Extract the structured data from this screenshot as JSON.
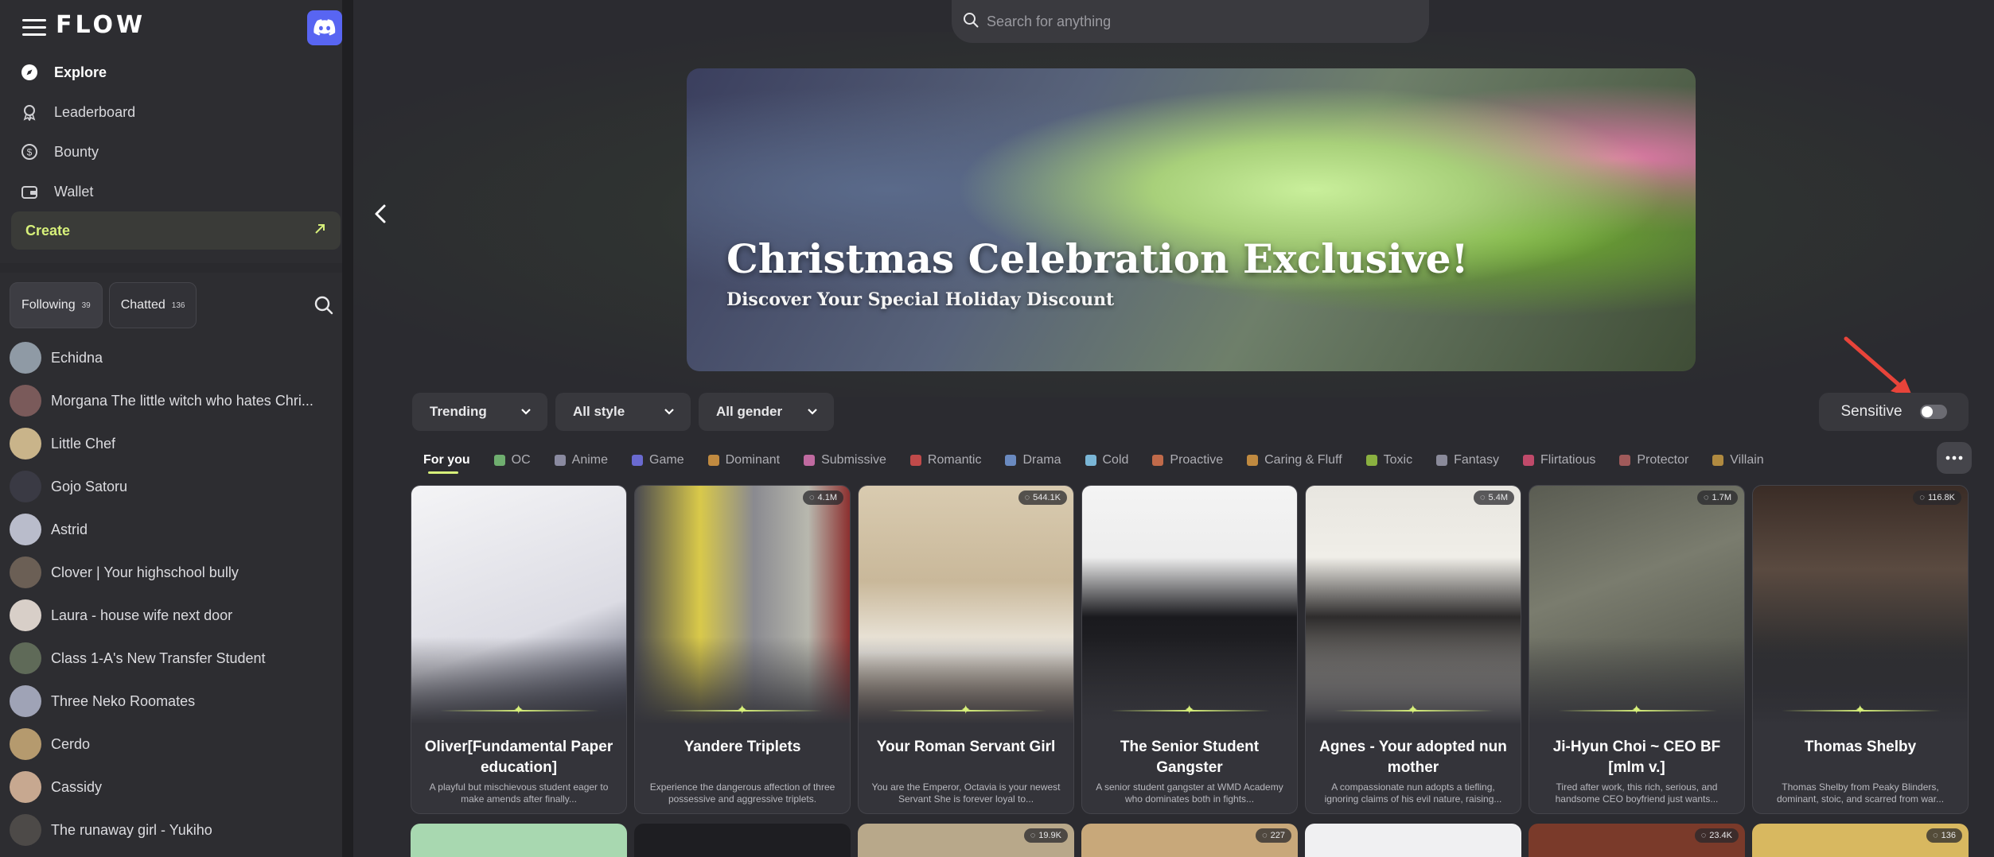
{
  "app": {
    "logo": "FLOW",
    "discord_icon": "discord-icon"
  },
  "nav": {
    "items": [
      {
        "label": "Explore",
        "icon": "compass-icon",
        "active": true
      },
      {
        "label": "Leaderboard",
        "icon": "medal-icon",
        "active": false
      },
      {
        "label": "Bounty",
        "icon": "dollar-icon",
        "active": false
      },
      {
        "label": "Wallet",
        "icon": "wallet-icon",
        "active": false
      }
    ],
    "create_label": "Create"
  },
  "sidebar": {
    "tabs": [
      {
        "label": "Following",
        "count": "39",
        "active": true
      },
      {
        "label": "Chatted",
        "count": "136",
        "active": false
      }
    ],
    "chats": [
      {
        "name": "Echidna",
        "color": "#8f9aa5"
      },
      {
        "name": "Morgana The little witch who hates Chri...",
        "color": "#7a5a5a"
      },
      {
        "name": "Little Chef",
        "color": "#c9b48a"
      },
      {
        "name": "Gojo Satoru",
        "color": "#3a3a44"
      },
      {
        "name": "Astrid",
        "color": "#b9bccb"
      },
      {
        "name": "Clover | Your highschool bully",
        "color": "#6b5f55"
      },
      {
        "name": "Laura - house wife next door",
        "color": "#d8cfc8"
      },
      {
        "name": "Class 1-A's New Transfer Student",
        "color": "#5f6a58"
      },
      {
        "name": "Three Neko Roomates",
        "color": "#9fa3b6"
      },
      {
        "name": "Cerdo",
        "color": "#b59a6e"
      },
      {
        "name": "Cassidy",
        "color": "#c7a890"
      },
      {
        "name": "The runaway girl - Yukiho",
        "color": "#4d4a48"
      }
    ]
  },
  "search": {
    "placeholder": "Search for anything"
  },
  "banner": {
    "title": "Christmas Celebration Exclusive!",
    "subtitle": "Discover Your Special Holiday Discount"
  },
  "filters": {
    "sort": "Trending",
    "style": "All style",
    "gender": "All gender",
    "sensitive_label": "Sensitive",
    "sensitive_on": false
  },
  "categories": [
    {
      "label": "For you",
      "active": true,
      "color": ""
    },
    {
      "label": "OC",
      "color": "#6fae6f"
    },
    {
      "label": "Anime",
      "color": "#8a8aa0"
    },
    {
      "label": "Game",
      "color": "#6a6ad0"
    },
    {
      "label": "Dominant",
      "color": "#c08a40"
    },
    {
      "label": "Submissive",
      "color": "#c06aa0"
    },
    {
      "label": "Romantic",
      "color": "#c04a4a"
    },
    {
      "label": "Drama",
      "color": "#6a8ac0"
    },
    {
      "label": "Cold",
      "color": "#7ab6d6"
    },
    {
      "label": "Proactive",
      "color": "#c06a4a"
    },
    {
      "label": "Caring & Fluff",
      "color": "#c08a40"
    },
    {
      "label": "Toxic",
      "color": "#8ab040"
    },
    {
      "label": "Fantasy",
      "color": "#8a8a9a"
    },
    {
      "label": "Flirtatious",
      "color": "#c04a6a"
    },
    {
      "label": "Protector",
      "color": "#a05a5a"
    },
    {
      "label": "Villain",
      "color": "#b08a40"
    }
  ],
  "cards": [
    {
      "name": "Oliver[Fundamental Paper education]",
      "views": "",
      "desc": "A playful but mischievous student eager to make amends after finally...",
      "bg": "linear-gradient(160deg,#f4f4f6 0%,#dcdce4 60%,#2a2f45 100%)"
    },
    {
      "name": "Yandere Triplets",
      "views": "4.1M",
      "desc": "Experience the dangerous affection of three possessive and aggressive triplets.",
      "bg": "linear-gradient(90deg,#4a4a50 0%,#d9c94a 30%,#8a8a90 55%,#b8b8ae 80%,#8a2a2a 100%)"
    },
    {
      "name": "Your Roman Servant Girl",
      "views": "544.1K",
      "desc": "You are the Emperor, Octavia is your newest Servant She is forever loyal to...",
      "bg": "linear-gradient(180deg,#d9cbb0 0%,#c9b89a 40%,#f0ece4 70%,#a88a6a 100%)"
    },
    {
      "name": "The Senior Student Gangster",
      "views": "",
      "desc": "A senior student gangster at WMD Academy who dominates both in fights...",
      "bg": "linear-gradient(180deg,#f4f4f4 0%,#ededed 30%,#1a1a1e 55%,#2a2a2e 100%)"
    },
    {
      "name": "Agnes - Your adopted nun mother",
      "views": "5.4M",
      "desc": "A compassionate nun adopts a tiefling, ignoring claims of his evil nature, raising...",
      "bg": "linear-gradient(180deg,#e8e6e0 0%,#f0eee8 30%,#2e2c2c 55%,#dad6cc 100%)"
    },
    {
      "name": "Ji-Hyun Choi ~ CEO BF [mlm v.]",
      "views": "1.7M",
      "desc": "Tired after work, this rich, serious, and handsome CEO boyfriend just wants...",
      "bg": "linear-gradient(160deg,#5a5c52 0%,#7a7c6e 40%,#4a4c44 100%)"
    },
    {
      "name": "Thomas Shelby",
      "views": "116.8K",
      "desc": "Thomas Shelby from Peaky Blinders, dominant, stoic, and scarred from war...",
      "bg": "linear-gradient(180deg,#3a2c26 0%,#5a4a40 35%,#2e2e30 70%,#1e1e22 100%)"
    }
  ],
  "cards_row2": [
    {
      "views": "",
      "bg": "#a8d8b0"
    },
    {
      "views": "",
      "bg": "#1e1e22"
    },
    {
      "views": "19.9K",
      "bg": "#b8a88a"
    },
    {
      "views": "227",
      "bg": "#c8a87a"
    },
    {
      "views": "",
      "bg": "#f0f0f2"
    },
    {
      "views": "23.4K",
      "bg": "#7a3a2a"
    },
    {
      "views": "136",
      "bg": "#d8b860"
    }
  ]
}
